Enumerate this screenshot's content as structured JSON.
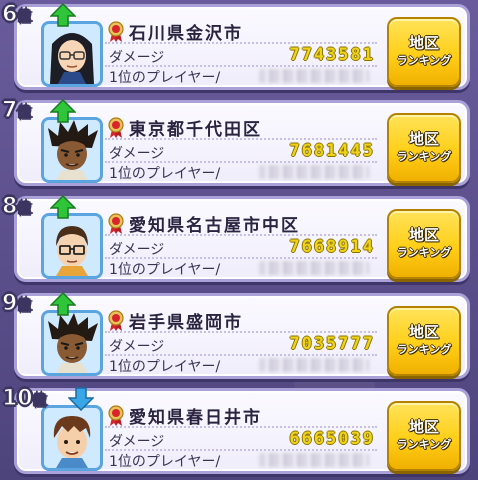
{
  "rows": [
    {
      "rank_num": "6",
      "rank_suffix": "位",
      "trend": "up",
      "region": "石川県金沢市",
      "damage_label": "ダメージ",
      "damage": "7743581",
      "player_label": "1位のプレイヤー/",
      "avatar": "avatar-girl-glasses"
    },
    {
      "rank_num": "7",
      "rank_suffix": "位",
      "trend": "up",
      "region": "東京都千代田区",
      "damage_label": "ダメージ",
      "damage": "7681445",
      "player_label": "1位のプレイヤー/",
      "avatar": "avatar-spiky-hair"
    },
    {
      "rank_num": "8",
      "rank_suffix": "位",
      "trend": "up",
      "region": "愛知県名古屋市中区",
      "damage_label": "ダメージ",
      "damage": "7668914",
      "player_label": "1位のプレイヤー/",
      "avatar": "avatar-glasses-boy"
    },
    {
      "rank_num": "9",
      "rank_suffix": "位",
      "trend": "up",
      "region": "岩手県盛岡市",
      "damage_label": "ダメージ",
      "damage": "7035777",
      "player_label": "1位のプレイヤー/",
      "avatar": "avatar-spiky-hair"
    },
    {
      "rank_num": "10",
      "rank_suffix": "位",
      "trend": "down",
      "region": "愛知県春日井市",
      "damage_label": "ダメージ",
      "damage": "6665039",
      "player_label": "1位のプレイヤー/",
      "avatar": "avatar-brown-hair-boy"
    }
  ],
  "button": {
    "line1": "地区",
    "line2": "ランキング"
  },
  "colors": {
    "up": "#2fc53a",
    "down": "#3aa6e8",
    "damage": "#efd21a",
    "button": "#ffcf18",
    "card_border": "#a9a1d8"
  }
}
